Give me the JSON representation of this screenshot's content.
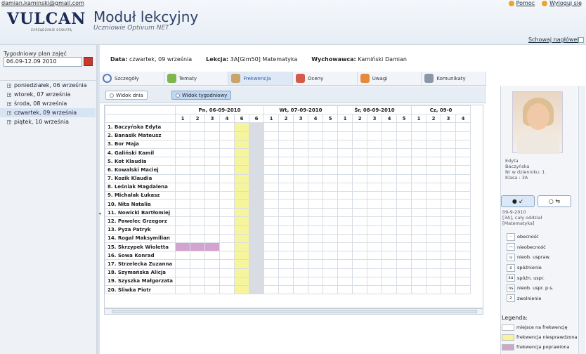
{
  "header": {
    "email": "damian.kaminski@gmail.com",
    "logo": "VULCAN",
    "logo_sub": "ZARZĄDZANIE OŚWIATĄ",
    "module_title": "Moduł lekcyjny",
    "module_subtitle": "Uczniowie Optivum NET",
    "help": "Pomoc",
    "logout": "Wyloguj się",
    "show_headers": "Schowaj nagłówek"
  },
  "left": {
    "plan_label": "Tygodniowy plan zajęć",
    "plan_value": "06.09-12.09 2010",
    "days": [
      {
        "label": "poniedziałek, 06 września"
      },
      {
        "label": "wtorek, 07 września"
      },
      {
        "label": "środa, 08 września"
      },
      {
        "label": "czwartek, 09 września",
        "selected": true
      },
      {
        "label": "piątek, 10 września"
      }
    ]
  },
  "info": {
    "data_label": "Data:",
    "data_value": "czwartek, 09 września",
    "lekcja_label": "Lekcja:",
    "lekcja_value": "3A[Gim50]  Matematyka",
    "wych_label": "Wychowawca:",
    "wych_value": "Kamiński Damian"
  },
  "tabs": [
    "Szczegóły",
    "Tematy",
    "Frekwencja",
    "Oceny",
    "Uwagi",
    "Komunikaty"
  ],
  "view": {
    "day": "Widok dnia",
    "week": "Widok tygodniowy"
  },
  "grid": {
    "days": [
      {
        "label": "Pn, 06-09-2010",
        "lessons": [
          "1",
          "2",
          "3",
          "4",
          "6",
          "6"
        ]
      },
      {
        "label": "Wt, 07-09-2010",
        "lessons": [
          "1",
          "2",
          "3",
          "4",
          "5"
        ]
      },
      {
        "label": "Śr, 08-09-2010",
        "lessons": [
          "1",
          "2",
          "3",
          "4",
          "5"
        ]
      },
      {
        "label": "Cz, 09-0",
        "lessons": [
          "1",
          "2",
          "3",
          "4"
        ]
      }
    ],
    "students": [
      "1. Baczyńska Edyta",
      "2. Banasik Mateusz",
      "3. Bor Maja",
      "4. Galiński Kamil",
      "5. Kot Klaudia",
      "6. Kowalski Maciej",
      "7. Kozik Klaudia",
      "8. Leśniak Magdalena",
      "9. Michalak Łukasz",
      "10. Nita Natalia",
      "11. Nowicki Bartłomiej",
      "12. Pawelec Grzegorz",
      "13. Pyza Patryk",
      "14. Rogal Maksymilian",
      "15. Skrzypek Wioletta",
      "16. Sowa Konrad",
      "17. Strzelecka Zuzanna",
      "18. Szymańska Alicja",
      "19. Szyszka Małgorzata",
      "20. Śliwka Piotr"
    ]
  },
  "student": {
    "first": "Edyta",
    "last": "Baczyńska",
    "nr": "Nr w dzienniku:  1",
    "klasa": "Klasa :  3A"
  },
  "lesson": {
    "date": "09-9-2010",
    "desc": "[3A], cały oddział",
    "subject": "[Matematyka]"
  },
  "codes": [
    {
      "k": "·",
      "label": "obecność"
    },
    {
      "k": "—",
      "label": "nieobecność"
    },
    {
      "k": "u",
      "label": "nieob. uspraw."
    },
    {
      "k": "s",
      "label": "spóźnienie"
    },
    {
      "k": "su",
      "label": "spóźn. uspr."
    },
    {
      "k": "ns",
      "label": "nieob. uspr. p.s."
    },
    {
      "k": "z",
      "label": "zwolnienie"
    }
  ],
  "legend": {
    "title": "Legenda:",
    "items": [
      {
        "label": "miejsce na frekwencję",
        "color": "#ffffff"
      },
      {
        "label": "frekwencja niesprawdzona",
        "color": "#f6f59b"
      },
      {
        "label": "frekwencja poprawiona",
        "color": "#d4a4d0"
      }
    ]
  }
}
